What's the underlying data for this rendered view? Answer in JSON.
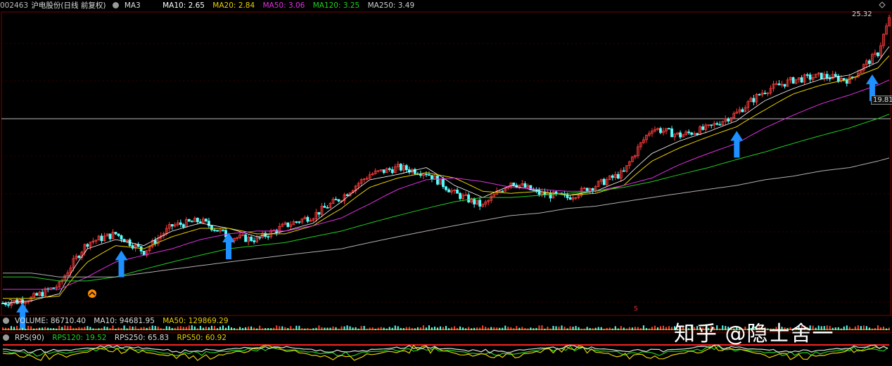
{
  "header": {
    "code": "002463",
    "name": "沪电股份(日线 前复权)",
    "ma3": "MA3",
    "ma10": "MA10: 2.65",
    "ma20": "MA20: 2.84",
    "ma50": "MA50: 3.06",
    "ma120": "MA120: 3.25",
    "ma250": "MA250: 3.49"
  },
  "price_labels": {
    "high": "25.32",
    "mid": "19.81",
    "low": "2.57",
    "signal": "S"
  },
  "volume_header": {
    "label": "VOLUME: 86710.40",
    "ma10": "MA10: 94681.95",
    "ma50": "MA50: 129869.29"
  },
  "rps_header": {
    "label": "RPS(90)",
    "rps120": "RPS120: 19.52",
    "rps250": "RPS250: 65.83",
    "rps50": "RPS50: 60.92"
  },
  "watermark": "知乎 @隐士舍一",
  "colors": {
    "up": "#ff3b3b",
    "down": "#54ffff",
    "ma10": "#ffffff",
    "ma20": "#e8d000",
    "ma50": "#e030e0",
    "ma120": "#20d020",
    "ma250": "#b0b0b0",
    "arrow": "#1e90ff"
  },
  "chart_data": {
    "type": "line",
    "note_axis": "x = trading-day index (approx.), y = price (forward-adjusted CNY)",
    "ylim": [
      2.4,
      25.6
    ],
    "x": [
      0,
      20,
      40,
      60,
      80,
      100,
      120,
      140,
      160,
      180,
      200,
      220,
      240,
      260,
      280,
      300,
      320,
      340,
      360,
      380,
      400,
      420,
      440,
      460,
      480,
      500,
      520,
      540,
      560,
      580,
      600,
      620,
      628
    ],
    "series": [
      {
        "name": "MA10",
        "values": [
          2.6,
          2.65,
          2.8,
          4.0,
          4.3,
          4.1,
          4.6,
          4.9,
          4.7,
          4.4,
          4.6,
          4.9,
          5.8,
          6.9,
          7.2,
          7.6,
          6.6,
          6.0,
          6.6,
          6.3,
          6.1,
          6.3,
          6.9,
          8.5,
          9.4,
          10.1,
          11.0,
          12.9,
          14.2,
          15.3,
          15.8,
          17.5,
          19.8
        ]
      },
      {
        "name": "MA20",
        "values": [
          2.7,
          2.7,
          2.75,
          3.6,
          4.1,
          4.0,
          4.4,
          4.7,
          4.7,
          4.5,
          4.5,
          4.8,
          5.5,
          6.5,
          7.0,
          7.3,
          7.0,
          6.3,
          6.2,
          6.3,
          6.1,
          6.2,
          6.6,
          8.0,
          8.9,
          9.7,
          10.5,
          12.0,
          13.6,
          14.6,
          15.3,
          16.7,
          18.4
        ]
      },
      {
        "name": "MA50",
        "values": [
          2.9,
          2.9,
          2.9,
          3.2,
          3.6,
          3.8,
          4.0,
          4.3,
          4.5,
          4.6,
          4.6,
          4.8,
          5.1,
          5.7,
          6.4,
          6.9,
          7.0,
          6.8,
          6.5,
          6.4,
          6.3,
          6.3,
          6.6,
          7.0,
          7.8,
          8.5,
          9.2,
          10.4,
          11.5,
          12.6,
          13.5,
          14.6,
          15.2
        ]
      },
      {
        "name": "MA120",
        "values": [
          3.2,
          3.2,
          3.1,
          3.1,
          3.2,
          3.4,
          3.6,
          3.8,
          4.0,
          4.1,
          4.2,
          4.4,
          4.6,
          4.9,
          5.2,
          5.5,
          5.8,
          6.0,
          6.0,
          6.1,
          6.2,
          6.3,
          6.5,
          6.8,
          7.2,
          7.6,
          8.1,
          8.6,
          9.2,
          9.8,
          10.4,
          11.2,
          11.6
        ]
      },
      {
        "name": "MA250",
        "values": [
          3.3,
          3.3,
          3.2,
          3.2,
          3.2,
          3.3,
          3.4,
          3.5,
          3.6,
          3.7,
          3.8,
          3.9,
          4.0,
          4.2,
          4.4,
          4.6,
          4.8,
          5.0,
          5.2,
          5.3,
          5.5,
          5.6,
          5.8,
          6.0,
          6.2,
          6.4,
          6.6,
          6.9,
          7.1,
          7.4,
          7.6,
          8.0,
          8.2
        ]
      },
      {
        "name": "Close",
        "values": [
          2.6,
          2.7,
          3.0,
          4.2,
          4.5,
          3.9,
          4.8,
          5.0,
          4.4,
          4.3,
          4.8,
          5.2,
          6.0,
          7.2,
          7.6,
          7.3,
          6.2,
          5.6,
          6.8,
          6.2,
          6.0,
          6.6,
          7.3,
          10.4,
          9.8,
          10.4,
          11.7,
          14.0,
          15.2,
          15.7,
          15.2,
          18.8,
          24.5
        ]
      }
    ],
    "markers": {
      "arrows_at_x": [
        14,
        84,
        160,
        520,
        616
      ]
    },
    "ref_line_y": 19.81,
    "max_label": 25.32,
    "min_label": 2.57
  }
}
